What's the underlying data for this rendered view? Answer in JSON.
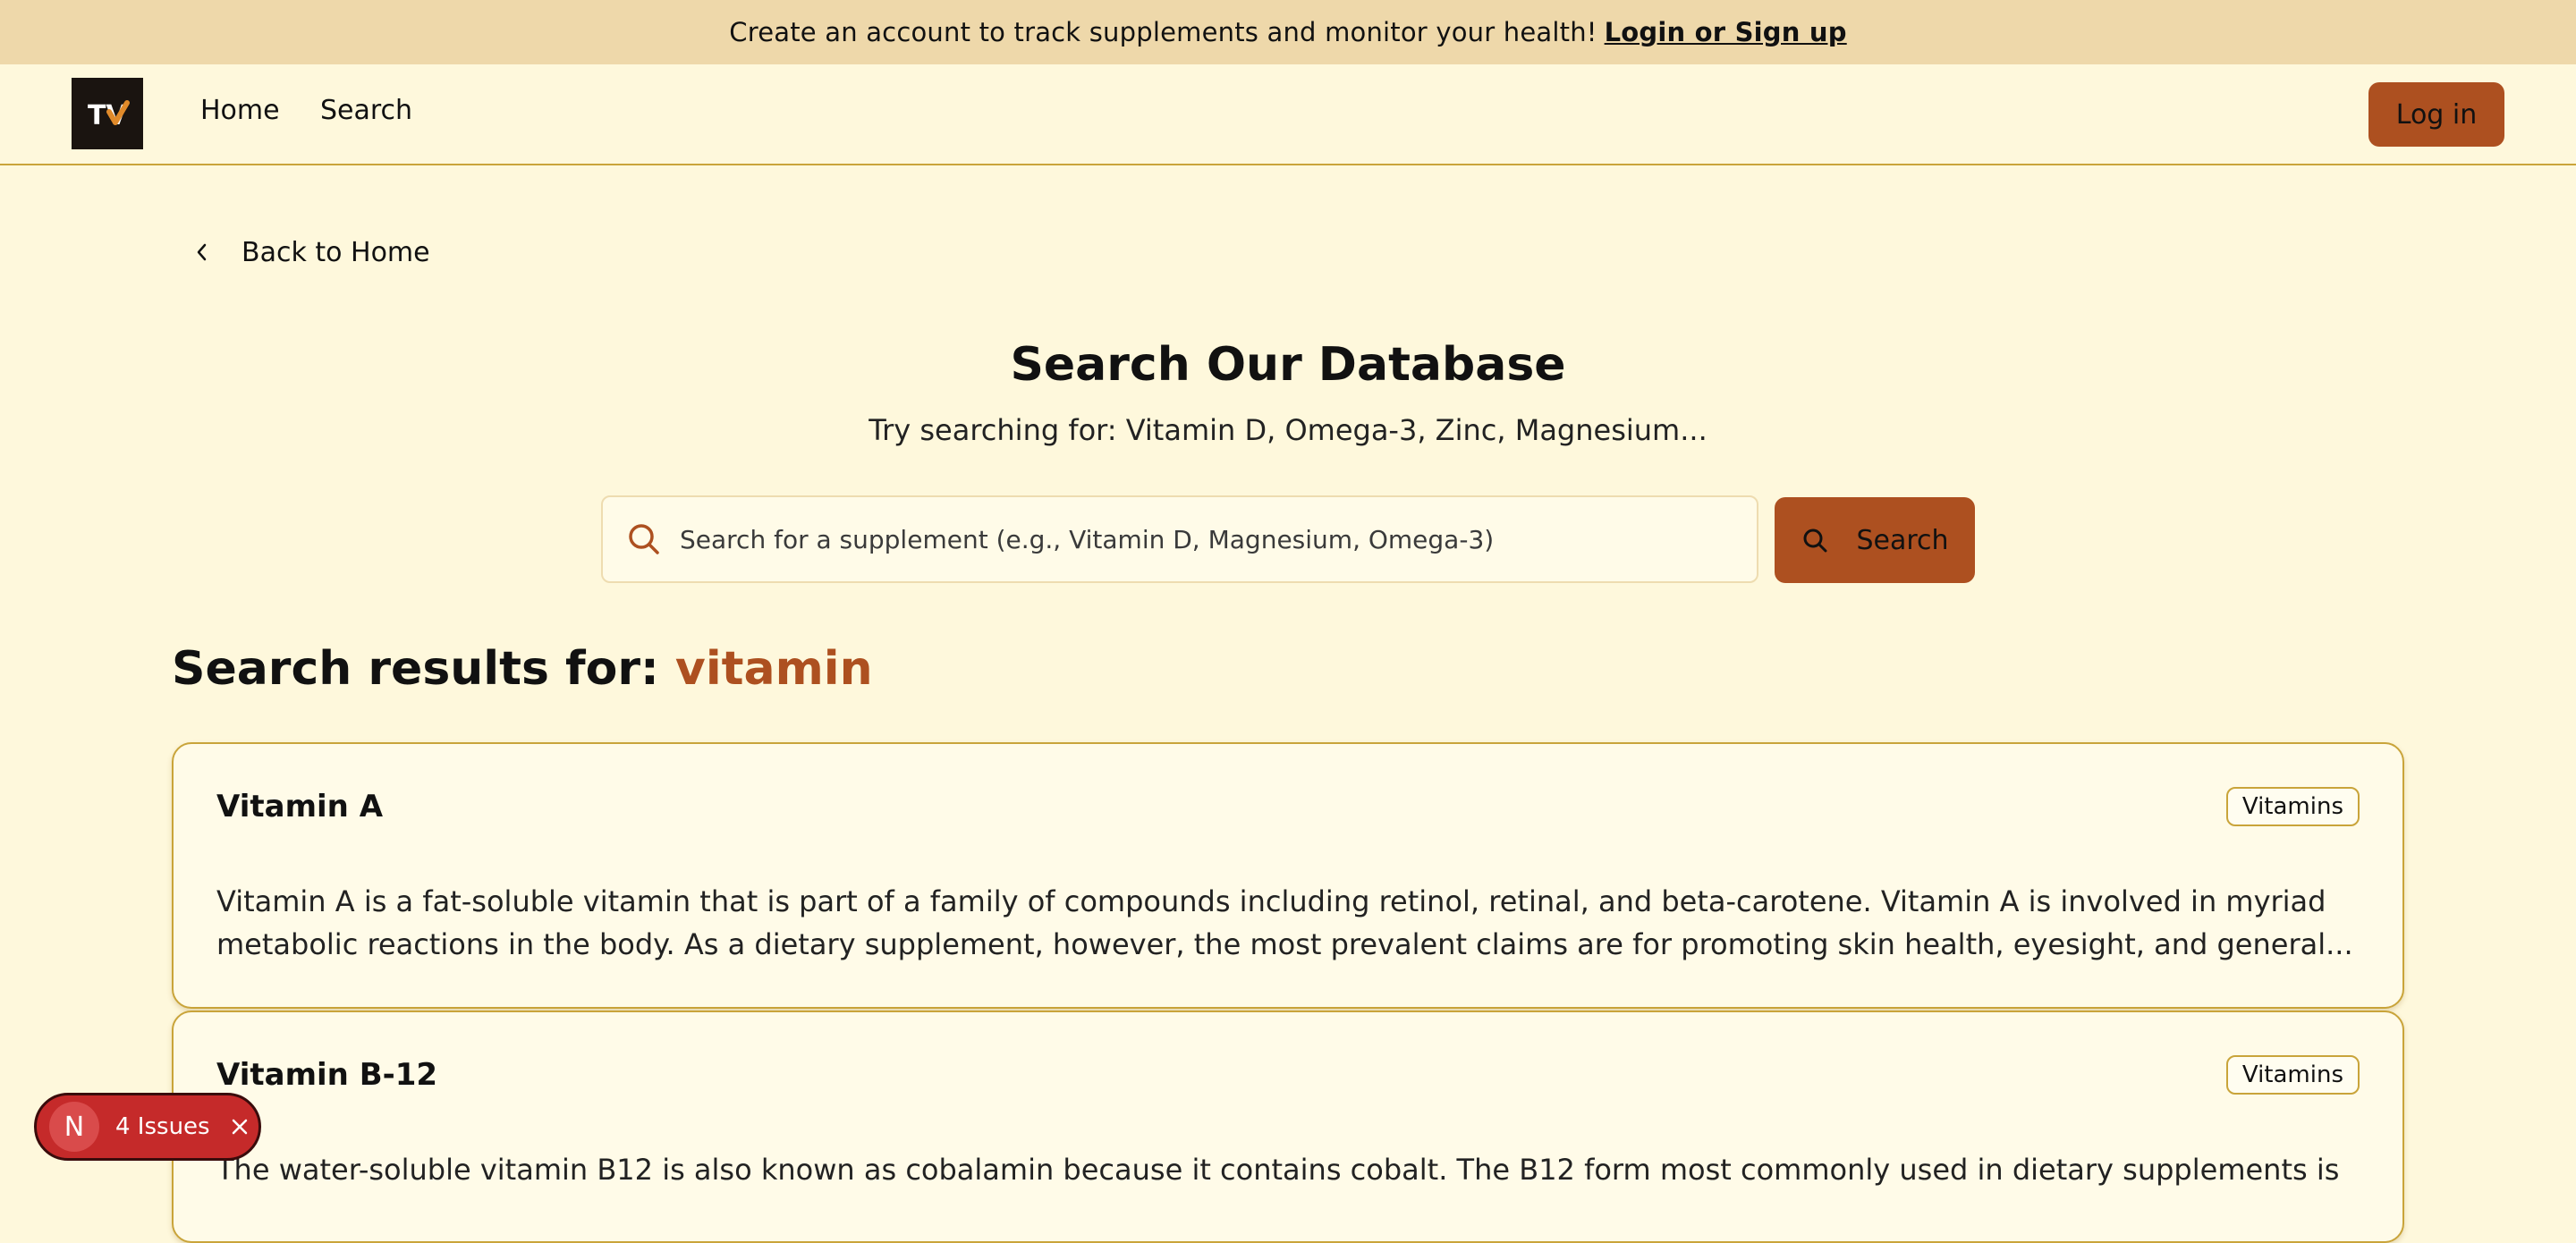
{
  "banner": {
    "text": "Create an account to track supplements and monitor your health!",
    "link_label": "Login or Sign up"
  },
  "nav": {
    "logo_text": "TV",
    "links": [
      "Home",
      "Search"
    ],
    "login_label": "Log in"
  },
  "back_link": "Back to Home",
  "page": {
    "title": "Search Our Database",
    "subtitle": "Try searching for: Vitamin D, Omega-3, Zinc, Magnesium..."
  },
  "search": {
    "placeholder": "Search for a supplement (e.g., Vitamin D, Magnesium, Omega-3)",
    "value": "",
    "button_label": "Search"
  },
  "results": {
    "heading_prefix": "Search results for:",
    "term": "vitamin",
    "items": [
      {
        "title": "Vitamin A",
        "category": "Vitamins",
        "description": "Vitamin A is a fat-soluble vitamin that is part of a family of compounds including retinol, retinal, and beta-carotene. Vitamin A is involved in myriad metabolic reactions in the body. As a dietary supplement, however, the most prevalent claims are for promoting skin health, eyesight, and general..."
      },
      {
        "title": "Vitamin B-12",
        "category": "Vitamins",
        "description": "The water-soluble vitamin B12 is also known as cobalamin because it contains cobalt. The B12 form most commonly used in dietary supplements is"
      }
    ]
  },
  "issues_widget": {
    "avatar_letter": "N",
    "label": "4 Issues"
  },
  "colors": {
    "background": "#fef8dc",
    "banner": "#eed8aa",
    "accent": "#ad5020",
    "border": "#c9a43a",
    "issues": "#c52a2a"
  }
}
